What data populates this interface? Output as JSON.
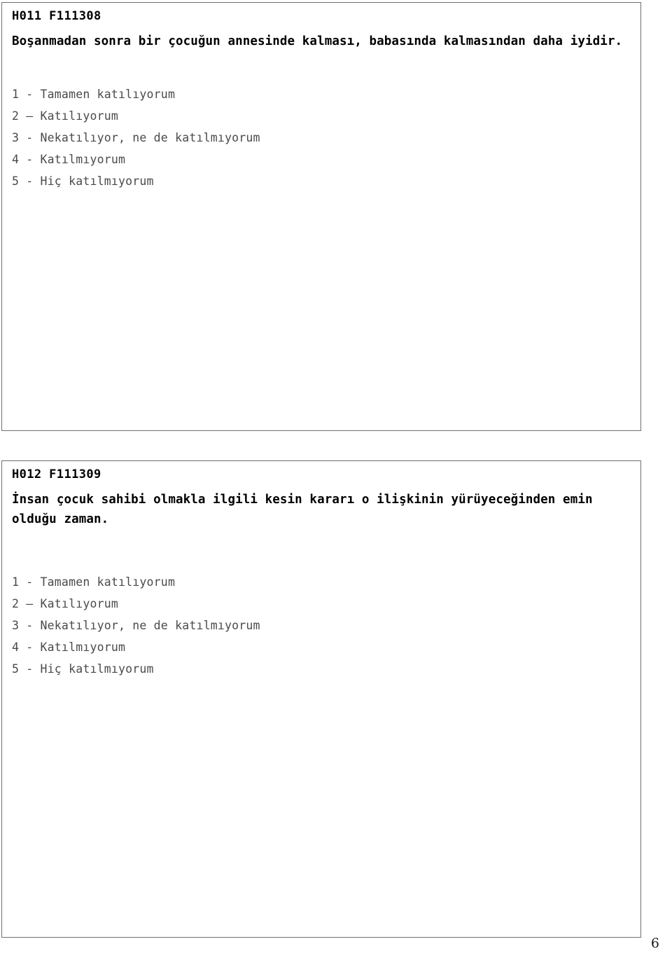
{
  "page": {
    "number": "6",
    "background_color": "#ffffff",
    "frame_color": "#6f6f6f",
    "heading_color": "#000000",
    "option_color": "#4a4a4a"
  },
  "questions": [
    {
      "code": "H011 F111308",
      "statement": "Boşanmadan sonra bir çocuğun annesinde kalması, babasında kalmasından daha iyidir.",
      "options": [
        "1 - Tamamen katılıyorum",
        "2 – Katılıyorum",
        "3 - Nekatılıyor, ne de katılmıyorum",
        "4 - Katılmıyorum",
        "5 - Hiç katılmıyorum"
      ]
    },
    {
      "code": "H012 F111309",
      "statement": "İnsan çocuk sahibi olmakla ilgili kesin kararı o ilişkinin yürüyeceğinden emin olduğu zaman.",
      "options": [
        "1 - Tamamen katılıyorum",
        "2 – Katılıyorum",
        "3 - Nekatılıyor, ne de katılmıyorum",
        "4 - Katılmıyorum",
        "5 - Hiç katılmıyorum"
      ]
    }
  ]
}
